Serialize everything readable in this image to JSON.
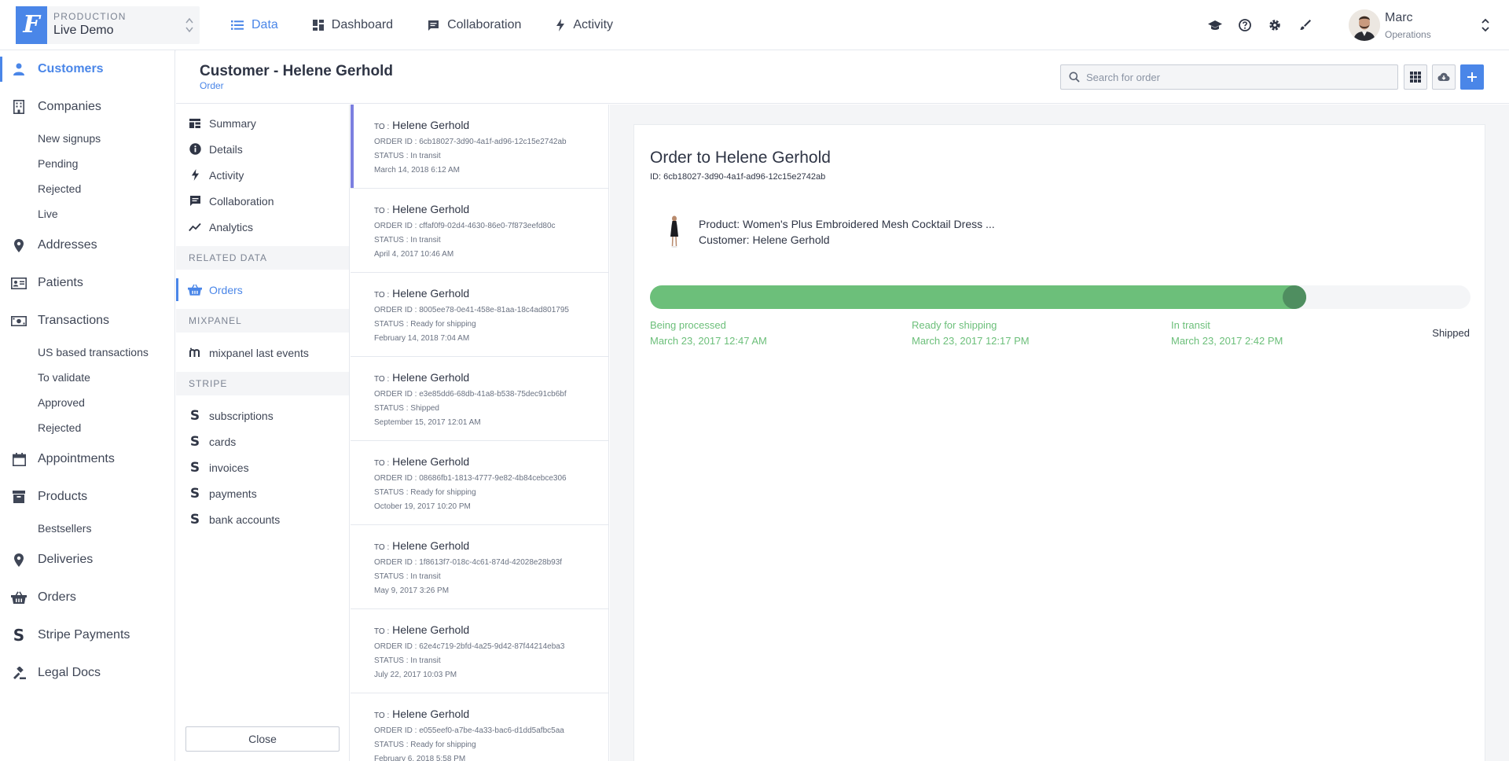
{
  "project": {
    "env": "PRODUCTION",
    "name": "Live Demo",
    "logo": "F"
  },
  "topnav": [
    {
      "label": "Data",
      "icon": "list-icon",
      "active": true
    },
    {
      "label": "Dashboard",
      "icon": "dashboard-icon"
    },
    {
      "label": "Collaboration",
      "icon": "chat-icon"
    },
    {
      "label": "Activity",
      "icon": "bolt-icon"
    }
  ],
  "topicons": [
    "graduation-cap-icon",
    "help-icon",
    "gear-icon",
    "brush-icon"
  ],
  "user": {
    "name": "Marc",
    "role": "Operations"
  },
  "leftnav": {
    "customers": "Customers",
    "companies": "Companies",
    "companies_sub": [
      "New signups",
      "Pending",
      "Rejected",
      "Live"
    ],
    "addresses": "Addresses",
    "patients": "Patients",
    "transactions": "Transactions",
    "transactions_sub": [
      "US based transactions",
      "To validate",
      "Approved",
      "Rejected"
    ],
    "appointments": "Appointments",
    "products": "Products",
    "products_sub": [
      "Bestsellers"
    ],
    "deliveries": "Deliveries",
    "orders": "Orders",
    "stripe_payments": "Stripe Payments",
    "legal_docs": "Legal Docs"
  },
  "header": {
    "title": "Customer - Helene Gerhold",
    "subtitle": "Order",
    "search_placeholder": "Search for order"
  },
  "recmenu": {
    "summary": "Summary",
    "details": "Details",
    "activity": "Activity",
    "collaboration": "Collaboration",
    "analytics": "Analytics",
    "related_data": "RELATED DATA",
    "orders": "Orders",
    "mixpanel": "MIXPANEL",
    "mixpanel_events": "mixpanel last events",
    "stripe": "STRIPE",
    "stripe_items": [
      "subscriptions",
      "cards",
      "invoices",
      "payments",
      "bank accounts"
    ],
    "close": "Close"
  },
  "orders": {
    "to_label": "TO :",
    "items": [
      {
        "to": "Helene Gerhold",
        "id": "ORDER ID : 6cb18027-3d90-4a1f-ad96-12c15e2742ab",
        "status": "STATUS : In transit",
        "date": "March 14, 2018 6:12 AM"
      },
      {
        "to": "Helene Gerhold",
        "id": "ORDER ID : cffaf0f9-02d4-4630-86e0-7f873eefd80c",
        "status": "STATUS : In transit",
        "date": "April 4, 2017 10:46 AM"
      },
      {
        "to": "Helene Gerhold",
        "id": "ORDER ID : 8005ee78-0e41-458e-81aa-18c4ad801795",
        "status": "STATUS : Ready for shipping",
        "date": "February 14, 2018 7:04 AM"
      },
      {
        "to": "Helene Gerhold",
        "id": "ORDER ID : e3e85dd6-68db-41a8-b538-75dec91cb6bf",
        "status": "STATUS : Shipped",
        "date": "September 15, 2017 12:01 AM"
      },
      {
        "to": "Helene Gerhold",
        "id": "ORDER ID : 08686fb1-1813-4777-9e82-4b84cebce306",
        "status": "STATUS : Ready for shipping",
        "date": "October 19, 2017 10:20 PM"
      },
      {
        "to": "Helene Gerhold",
        "id": "ORDER ID : 1f8613f7-018c-4c61-874d-42028e28b93f",
        "status": "STATUS : In transit",
        "date": "May 9, 2017 3:26 PM"
      },
      {
        "to": "Helene Gerhold",
        "id": "ORDER ID : 62e4c719-2bfd-4a25-9d42-87f44214eba3",
        "status": "STATUS : In transit",
        "date": "July 22, 2017 10:03 PM"
      },
      {
        "to": "Helene Gerhold",
        "id": "ORDER ID : e055eef0-a7be-4a33-bac6-d1dd5afbc5aa",
        "status": "STATUS : Ready for shipping",
        "date": "February 6, 2018 5:58 PM"
      }
    ]
  },
  "detail": {
    "title": "Order to Helene Gerhold",
    "id": "ID: 6cb18027-3d90-4a1f-ad96-12c15e2742ab",
    "product": "Product: Women's Plus Embroidered Mesh Cocktail Dress ...",
    "customer": "Customer: Helene Gerhold",
    "progress": 0.8,
    "steps": [
      {
        "label": "Being processed",
        "date": "March 23, 2017 12:47 AM"
      },
      {
        "label": "Ready for shipping",
        "date": "March 23, 2017 12:17 PM"
      },
      {
        "label": "In transit",
        "date": "March 23, 2017 2:42 PM"
      },
      {
        "label": "Shipped",
        "date": ""
      }
    ]
  },
  "colors": {
    "accent": "#4a86e8",
    "progress": "#6cbf7a",
    "progress_knob": "#4f8e60",
    "active_order": "#7c7fe0"
  }
}
